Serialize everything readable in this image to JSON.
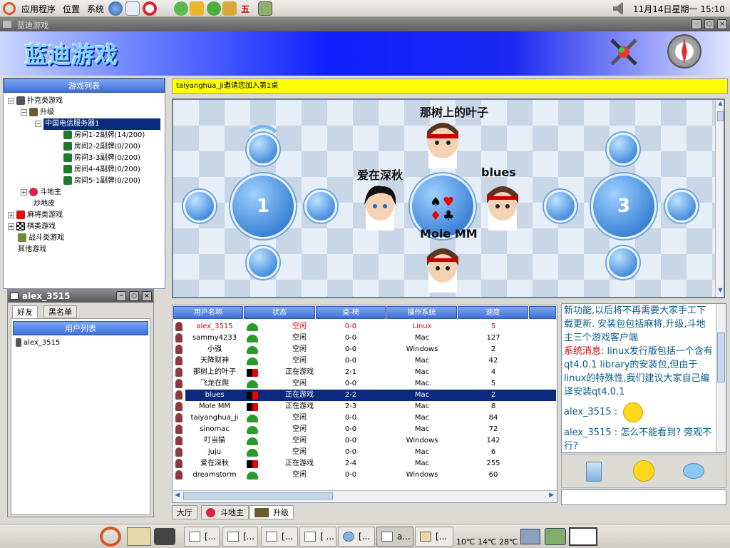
{
  "top_panel": {
    "menus": [
      "应用程序",
      "位置",
      "系统"
    ],
    "clock": "11月14日星期一 15:10",
    "center_glyph": "五"
  },
  "window": {
    "title": "蓝迪游戏"
  },
  "header": {
    "logo_text": "蓝迪游戏"
  },
  "tree": {
    "header": "游戏列表",
    "nodes": [
      {
        "label": "扑克类游戏"
      },
      {
        "label": "升级"
      },
      {
        "label": "中国电信服务器1"
      },
      {
        "label": "房间1-2副牌(14/200)"
      },
      {
        "label": "房间2-2副牌(0/200)"
      },
      {
        "label": "房间3-3副牌(0/200)"
      },
      {
        "label": "房间4-4副牌(0/200)"
      },
      {
        "label": "房间5-1副牌(0/200)"
      },
      {
        "label": "斗地主"
      },
      {
        "label": "炒地皮"
      },
      {
        "label": "麻将类游戏"
      },
      {
        "label": "棋类游戏"
      },
      {
        "label": "战斗类游戏"
      },
      {
        "label": "其他游戏"
      }
    ]
  },
  "friends": {
    "title": "alex_3515",
    "tabs": [
      "好友",
      "黑名单"
    ],
    "list_header": "用户列表",
    "users": [
      "alex_3515"
    ]
  },
  "game": {
    "invite": "taiyanghua_ji邀请您加入第1桌",
    "tables": [
      {
        "number": "1"
      },
      {
        "number": "3"
      }
    ],
    "players": {
      "top": "那树上的叶子",
      "left": "爱在深秋",
      "right": "blues",
      "bottom": "Mole MM"
    }
  },
  "user_table": {
    "columns": [
      "用户名称",
      "状态",
      "桌-椅",
      "操作系统",
      "速度"
    ],
    "rows": [
      {
        "name": "alex_3515",
        "status": "空闲",
        "seat": "0-0",
        "os": "Linux",
        "speed": "5"
      },
      {
        "name": "sammy4233",
        "status": "空闲",
        "seat": "0-0",
        "os": "Mac",
        "speed": "127"
      },
      {
        "name": "小强",
        "status": "空闲",
        "seat": "0-0",
        "os": "Windows",
        "speed": "2"
      },
      {
        "name": "天降财神",
        "status": "空闲",
        "seat": "0-0",
        "os": "Mac",
        "speed": "42"
      },
      {
        "name": "那树上的叶子",
        "status": "正在游戏",
        "seat": "2-1",
        "os": "Mac",
        "speed": "4"
      },
      {
        "name": "飞龙在爬",
        "status": "空闲",
        "seat": "0-0",
        "os": "Mac",
        "speed": "5"
      },
      {
        "name": "blues",
        "status": "正在游戏",
        "seat": "2-2",
        "os": "Mac",
        "speed": "2"
      },
      {
        "name": "Mole MM",
        "status": "正在游戏",
        "seat": "2-3",
        "os": "Mac",
        "speed": "8"
      },
      {
        "name": "taiyanghua_ji",
        "status": "空闲",
        "seat": "0-0",
        "os": "Mac",
        "speed": "84"
      },
      {
        "name": "sinomac",
        "status": "空闲",
        "seat": "0-0",
        "os": "Mac",
        "speed": "72"
      },
      {
        "name": "叮当猫",
        "status": "空闲",
        "seat": "0-0",
        "os": "Windows",
        "speed": "142"
      },
      {
        "name": "juju",
        "status": "空闲",
        "seat": "0-0",
        "os": "Mac",
        "speed": "6"
      },
      {
        "name": "爱在深秋",
        "status": "正在游戏",
        "seat": "2-4",
        "os": "Mac",
        "speed": "255"
      },
      {
        "name": "dreamstorm",
        "status": "空闲",
        "seat": "0-0",
        "os": "Windows",
        "speed": "60"
      }
    ]
  },
  "chat": {
    "messages": [
      {
        "text": "新功能,以后将不再需要大家手工下载更新. 安装包包括麻将,升级,斗地主三个游戏客户端"
      },
      {
        "prefix": "系统消息",
        "text": ": linux发行版包括一个含有qt4.0.1 library的安装包,但由于linux的特殊性,我们建议大家自己编译安装qt4.0.1"
      },
      {
        "prefix": "alex_3515",
        "text": ":"
      },
      {
        "prefix": "alex_3515",
        "text": ": 怎么不能看到? 旁观不行?"
      }
    ]
  },
  "bottom_tabs": [
    "大厅",
    "斗地主",
    "升级"
  ],
  "taskbar": {
    "tasks": [
      "[...",
      "[...",
      "[...",
      "[ ...",
      "[...",
      "a...",
      "[..."
    ],
    "weather": [
      "10℃",
      "14℃",
      "28℃"
    ]
  },
  "colors": {
    "accent": "#0a2a7d",
    "invite_bg": "#ffff00",
    "red_text": "#e00000",
    "chat_text": "#0a5a8a"
  }
}
